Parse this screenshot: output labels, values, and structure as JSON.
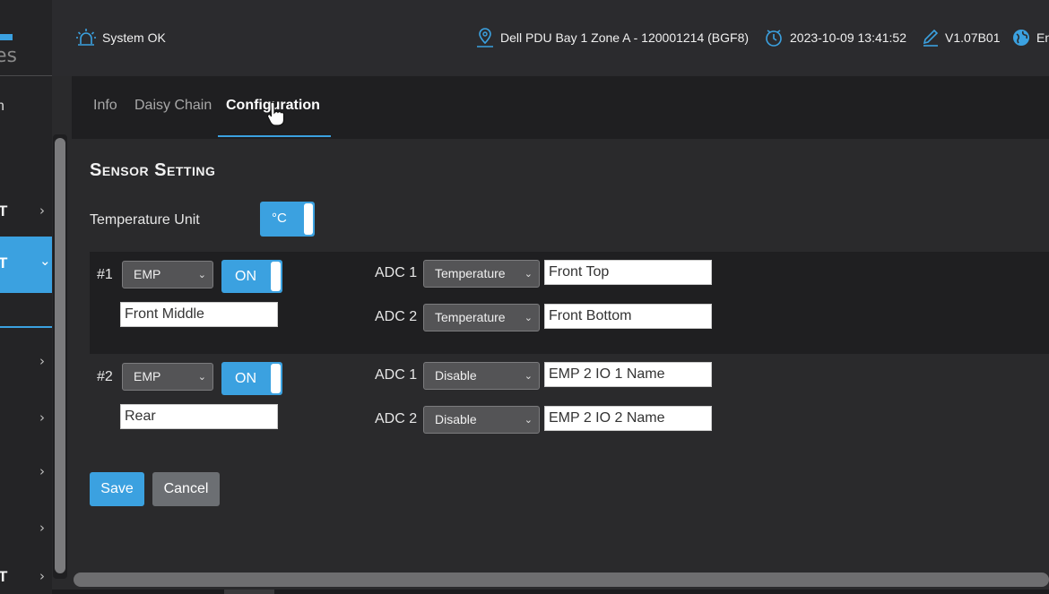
{
  "sidebar": {
    "brand_fragment": "es",
    "top_fragment": "n",
    "items": [
      {
        "label": "T",
        "chevron": "›"
      },
      {
        "label": "T",
        "chevron": "⌄"
      },
      {
        "label": "",
        "chevron": "›"
      },
      {
        "label": "",
        "chevron": "›"
      },
      {
        "label": "",
        "chevron": "›"
      },
      {
        "label": "",
        "chevron": "›"
      },
      {
        "label": "T",
        "chevron": "›"
      }
    ]
  },
  "topbar": {
    "status": "System OK",
    "location": "Dell PDU Bay 1 Zone A - 120001214 (BGF8)",
    "datetime": "2023-10-09 13:41:52",
    "version": "V1.07B01",
    "language": "Eng"
  },
  "tabs": [
    {
      "label": "Info"
    },
    {
      "label": "Daisy Chain"
    },
    {
      "label": "Configuration"
    }
  ],
  "section": {
    "title": "Sensor Setting",
    "temperature_unit_label": "Temperature Unit",
    "temperature_unit_value": "°C"
  },
  "sensors": [
    {
      "number": "#1",
      "type": "EMP",
      "state": "ON",
      "name": "Front Middle",
      "adc": [
        {
          "label": "ADC 1",
          "mode": "Temperature",
          "name": "Front Top"
        },
        {
          "label": "ADC 2",
          "mode": "Temperature",
          "name": "Front Bottom"
        }
      ]
    },
    {
      "number": "#2",
      "type": "EMP",
      "state": "ON",
      "name": "Rear",
      "adc": [
        {
          "label": "ADC 1",
          "mode": "Disable",
          "name": "EMP 2 IO 1 Name"
        },
        {
          "label": "ADC 2",
          "mode": "Disable",
          "name": "EMP 2 IO 2 Name"
        }
      ]
    }
  ],
  "buttons": {
    "save": "Save",
    "cancel": "Cancel"
  },
  "colors": {
    "accent": "#3ba1e0",
    "background": "#2a2a2c",
    "panel_dark": "#1f1f21",
    "cancel_button": "#6c6f73"
  },
  "icons": {
    "status": "alarm-light-icon",
    "location": "location-pin-icon",
    "datetime": "clock-sync-icon",
    "version": "pencil-icon",
    "language": "globe-icon",
    "dropdown": "chevron-down-icon"
  }
}
